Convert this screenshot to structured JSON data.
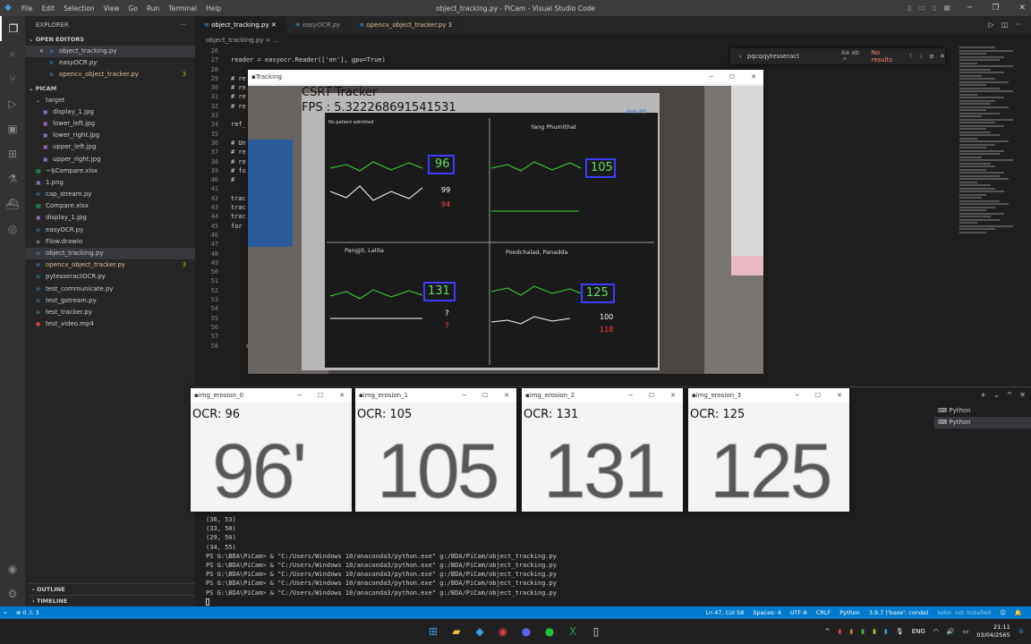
{
  "titlebar": {
    "menus": [
      "File",
      "Edit",
      "Selection",
      "View",
      "Go",
      "Run",
      "Terminal",
      "Help"
    ],
    "title": "object_tracking.py - PiCam - Visual Studio Code"
  },
  "sidebar": {
    "header": "EXPLORER",
    "open_editors_label": "OPEN EDITORS",
    "open_editors": [
      {
        "name": "object_tracking.py",
        "badge": ""
      },
      {
        "name": "easyOCR.py",
        "badge": ""
      },
      {
        "name": "opencv_object_tracker.py",
        "badge": "3"
      }
    ],
    "project_label": "PICAM",
    "files": [
      {
        "name": "target",
        "badge": ""
      },
      {
        "name": "display_1.jpg",
        "badge": ""
      },
      {
        "name": "lower_left.jpg",
        "badge": ""
      },
      {
        "name": "lower_right.jpg",
        "badge": ""
      },
      {
        "name": "upper_left.jpg",
        "badge": ""
      },
      {
        "name": "upper_right.jpg",
        "badge": ""
      },
      {
        "name": "~$Compare.xlsx",
        "badge": ""
      },
      {
        "name": "1.png",
        "badge": ""
      },
      {
        "name": "cap_stream.py",
        "badge": ""
      },
      {
        "name": "Compare.xlsx",
        "badge": ""
      },
      {
        "name": "display_1.jpg",
        "badge": ""
      },
      {
        "name": "easyOCR.py",
        "badge": ""
      },
      {
        "name": "Flow.drawio",
        "badge": ""
      },
      {
        "name": "object_tracking.py",
        "badge": ""
      },
      {
        "name": "opencv_object_tracker.py",
        "badge": "3"
      },
      {
        "name": "pytesseractOCR.py",
        "badge": ""
      },
      {
        "name": "test_communicate.py",
        "badge": ""
      },
      {
        "name": "test_gstream.py",
        "badge": ""
      },
      {
        "name": "test_tracker.py",
        "badge": ""
      },
      {
        "name": "test_video.mp4",
        "badge": ""
      }
    ],
    "outline_label": "OUTLINE",
    "timeline_label": "TIMELINE"
  },
  "editor": {
    "tabs": [
      {
        "label": "object_tracking.py"
      },
      {
        "label": "easyOCR.py"
      },
      {
        "label": "opencv_object_tracker.py 3"
      }
    ],
    "breadcrumb": "object_tracking.py > ...",
    "line_numbers": [
      "26",
      "27",
      "28",
      "29",
      "30",
      "31",
      "32",
      "33",
      "34",
      "35",
      "36",
      "37",
      "38",
      "39",
      "40",
      "41",
      "42",
      "43",
      "44",
      "45",
      "46",
      "47",
      "48",
      "49",
      "50",
      "51",
      "52",
      "53",
      "54",
      "55",
      "56",
      "57",
      "58"
    ],
    "code_lines": [
      "",
      "reader = easyocr.Reader(['en'], gpu=True)",
      "",
      "# re",
      "# re",
      "# re",
      "# re",
      "",
      "ref_",
      "",
      "# Un",
      "# re",
      "# re",
      "# fo",
      "#",
      "",
      "trac",
      "trac",
      "trac",
      "for",
      "",
      "",
      "",
      "",
      "",
      "",
      "",
      "",
      "",
      "",
      "",
      "",
      "    elif tracker_type == 'KCF':"
    ],
    "find_text": "pqcqqytesseract",
    "find_opts": "Aa  ab  .*",
    "find_result": "No results"
  },
  "tracking_window": {
    "title": "Tracking",
    "tracker_name": "CSRT Tracker",
    "fps": "FPS : 5.322268691541531",
    "monitor": {
      "brand": "PHILIPS",
      "beds": [
        {
          "name": "No patient admitted",
          "hr": "96",
          "spo2": "99",
          "pulse": "94"
        },
        {
          "name": "Yang Phumithat",
          "hr": "105",
          "spo2": "",
          "pulse": ""
        },
        {
          "name": "Pangjit, Lalita",
          "hr": "131",
          "spo2": "?",
          "pulse": "?"
        },
        {
          "name": "Poodchalad, Panadda",
          "hr": "125",
          "spo2": "100",
          "pulse": "118"
        }
      ]
    }
  },
  "ocr_windows": [
    {
      "title": "img_erosion_0",
      "label": "OCR: 96",
      "big": "96'"
    },
    {
      "title": "img_erosion_1",
      "label": "OCR: 105",
      "big": "105"
    },
    {
      "title": "img_erosion_2",
      "label": "OCR: 131",
      "big": "131"
    },
    {
      "title": "img_erosion_3",
      "label": "OCR: 125",
      "big": "125"
    }
  ],
  "terminal": {
    "lines": [
      "(36, 53)",
      "(33, 50)",
      "(29, 50)",
      "(34, 55)",
      "PS G:\\BDA\\PiCam> & \"C:/Users/Windows 10/anaconda3/python.exe\" g:/BDA/PiCam/object_tracking.py",
      "PS G:\\BDA\\PiCam> & \"C:/Users/Windows 10/anaconda3/python.exe\" g:/BDA/PiCam/object_tracking.py",
      "PS G:\\BDA\\PiCam> & \"C:/Users/Windows 10/anaconda3/python.exe\" g:/BDA/PiCam/object_tracking.py",
      "PS G:\\BDA\\PiCam> & \"C:/Users/Windows 10/anaconda3/python.exe\" g:/BDA/PiCam/object_tracking.py",
      "PS G:\\BDA\\PiCam> & \"C:/Users/Windows 10/anaconda3/python.exe\" g:/BDA/PiCam/object_tracking.py"
    ],
    "sessions": [
      "Python",
      "Python"
    ]
  },
  "statusbar": {
    "left": "⊗ 0 ⚠ 3",
    "position": "Ln 47, Col 58",
    "spaces": "Spaces: 4",
    "encoding": "UTF-8",
    "eol": "CRLF",
    "language": "Python",
    "interpreter": "3.9.7 ('base': conda)",
    "notice": "Is/ko: not installed"
  },
  "taskbar": {
    "lang": "ENG",
    "time": "21:11",
    "date": "03/04/2565"
  }
}
